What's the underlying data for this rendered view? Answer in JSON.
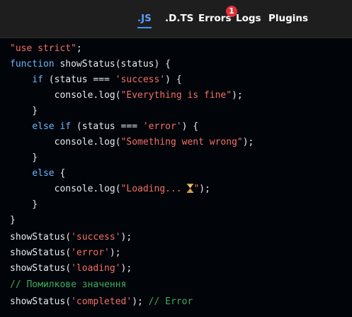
{
  "tabs": [
    {
      "label": ".JS",
      "active": true
    },
    {
      "label": ".D.TS",
      "active": false
    },
    {
      "label": "Errors",
      "active": false,
      "badge": "1"
    },
    {
      "label": "Logs",
      "active": false
    },
    {
      "label": "Plugins",
      "active": false
    }
  ],
  "colors": {
    "keyword": "#6cb6ff",
    "string": "#f47067",
    "comment": "#3fae5f",
    "active_tab": "#5b9cf6",
    "badge": "#e0303a",
    "editor_bg": "#010409"
  },
  "code": {
    "l1_str": "\"use strict\"",
    "l1_end": ";",
    "l2_kw": "function",
    "l2_rest": " showStatus(status) {",
    "l3_indent": "    ",
    "l3_kw": "if",
    "l3_mid": " (status === ",
    "l3_str": "'success'",
    "l3_end": ") {",
    "l4_indent": "        ",
    "l4_pre": "console.log(",
    "l4_str": "\"Everything is fine\"",
    "l4_end": ");",
    "l5": "    }",
    "l6_indent": "    ",
    "l6_kw": "else if",
    "l6_mid": " (status === ",
    "l6_str": "'error'",
    "l6_end": ") {",
    "l7_indent": "        ",
    "l7_pre": "console.log(",
    "l7_str": "\"Something went wrong\"",
    "l7_end": ");",
    "l8": "    }",
    "l9_indent": "    ",
    "l9_kw": "else",
    "l9_end": " {",
    "l10_indent": "        ",
    "l10_pre": "console.log(",
    "l10_str": "\"Loading... ",
    "l10_str_end": "\"",
    "l10_end": ");",
    "l11": "    }",
    "l12": "}",
    "l13_pre": "showStatus(",
    "l13_str": "'success'",
    "l13_end": ");",
    "l14_pre": "showStatus(",
    "l14_str": "'error'",
    "l14_end": ");",
    "l15_pre": "showStatus(",
    "l15_str": "'loading'",
    "l15_end": ");",
    "l16_cmt": "// Помилкове значення",
    "l17_pre": "showStatus(",
    "l17_str": "'completed'",
    "l17_mid": "); ",
    "l17_cmt": "// Error"
  },
  "emoji_icon": "hourglass-icon"
}
